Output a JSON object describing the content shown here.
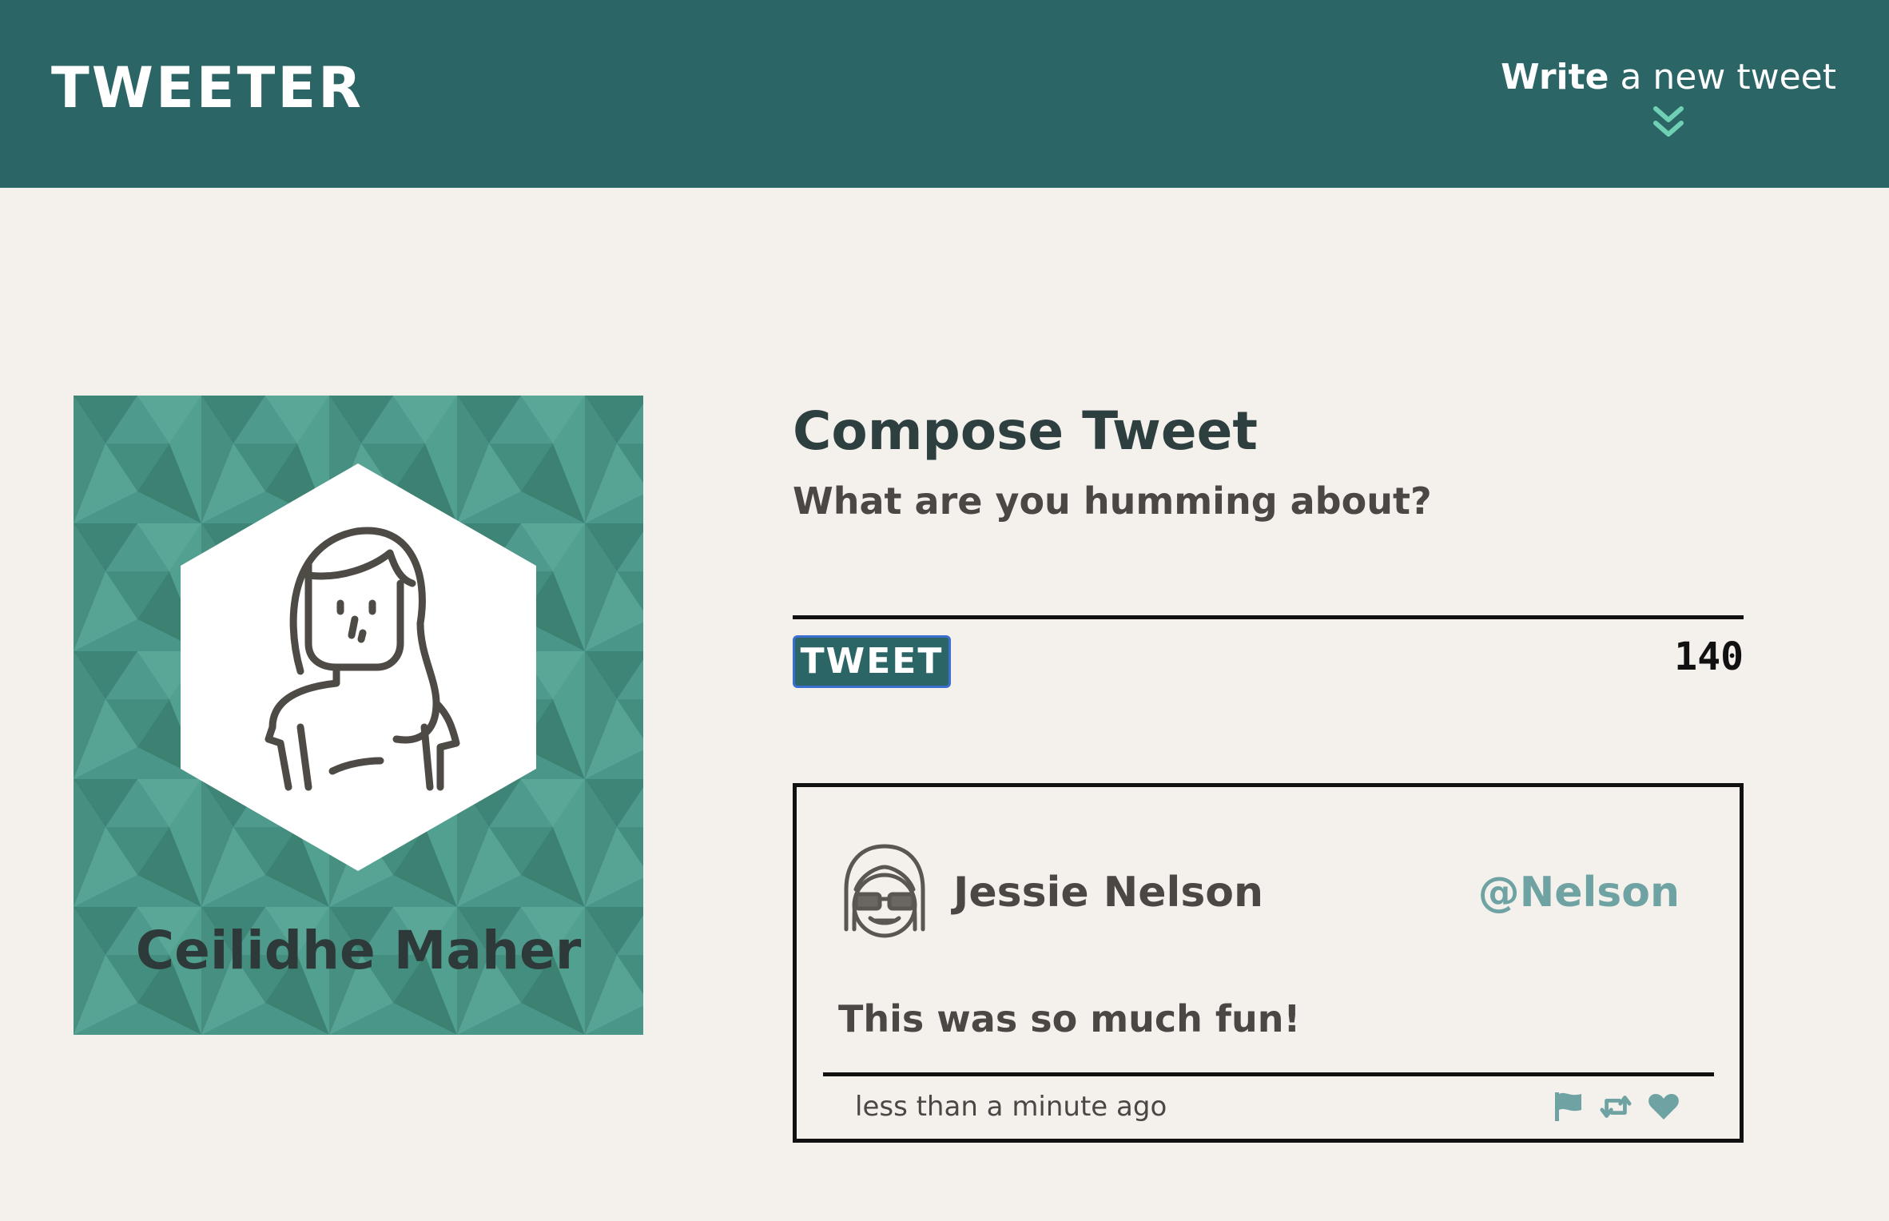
{
  "header": {
    "logo": "TWEETER",
    "write_bold": "Write",
    "write_rest": " a new tweet",
    "write_icon": "double-chevron-down-icon"
  },
  "profile": {
    "name": "Ceilidhe Maher",
    "avatar_icon": "woman-avatar-icon"
  },
  "compose": {
    "title": "Compose Tweet",
    "placeholder": "What are you humming about?",
    "button_label": "TWEET",
    "counter": "140"
  },
  "tweets": [
    {
      "name": "Jessie Nelson",
      "handle": "@Nelson",
      "text": "This was so much fun!",
      "time": "less than a minute ago",
      "avatar_icon": "glasses-girl-avatar-icon",
      "actions": [
        "flag-icon",
        "retweet-icon",
        "heart-icon"
      ]
    }
  ],
  "colors": {
    "header_bg": "#2b6566",
    "page_bg": "#f4f1ec",
    "accent": "#6fa3a3",
    "profile_bg": "#4e9a8c"
  }
}
